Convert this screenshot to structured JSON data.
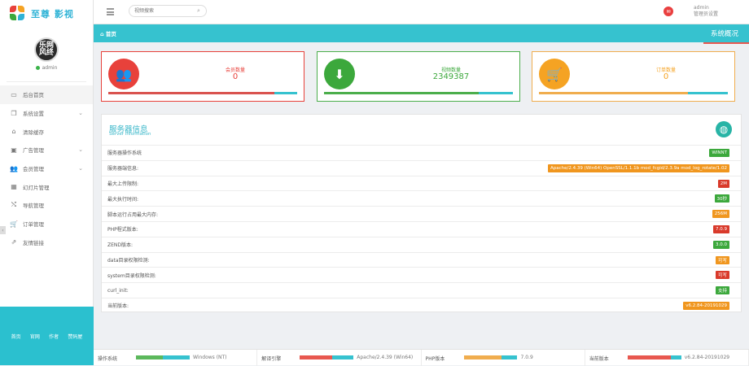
{
  "brand": {
    "name": "至尊 影视"
  },
  "profile": {
    "avatar_text": "乐网\n风终",
    "username": "admin"
  },
  "nav": [
    {
      "label": "后台首页",
      "icon": "monitor-icon",
      "has_chevron": false
    },
    {
      "label": "系统设置",
      "icon": "copy-icon",
      "has_chevron": true
    },
    {
      "label": "清除缓存",
      "icon": "building-icon",
      "has_chevron": false
    },
    {
      "label": "广告管理",
      "icon": "image-icon",
      "has_chevron": true
    },
    {
      "label": "会员管理",
      "icon": "users-icon",
      "has_chevron": true
    },
    {
      "label": "幻灯片管理",
      "icon": "table-icon",
      "has_chevron": false
    },
    {
      "label": "导航管理",
      "icon": "shuffle-icon",
      "has_chevron": false
    },
    {
      "label": "订单管理",
      "icon": "cart-icon",
      "has_chevron": false
    },
    {
      "label": "友情链接",
      "icon": "external-link-icon",
      "has_chevron": false
    }
  ],
  "side_footer": [
    "首页",
    "官网",
    "作者",
    "赞码屋"
  ],
  "topbar": {
    "search_placeholder": "视频搜索",
    "user_name": "admin",
    "user_role": "管理员设置"
  },
  "crumb": {
    "home": "首页",
    "title": "系统概况"
  },
  "stats": [
    {
      "label": "会员数量",
      "value": "0",
      "color": "#e8413b",
      "border": "#e8413b",
      "icon": "users-icon",
      "glyph": "👥",
      "bar": [
        {
          "c": "#d9534f",
          "w": 0.88
        },
        {
          "c": "#36c2cf",
          "w": 0.12
        }
      ]
    },
    {
      "label": "视频数量",
      "value": "2349387",
      "color": "#3ca83c",
      "border": "#4cae4c",
      "icon": "download-icon",
      "glyph": "⬇",
      "bar": [
        {
          "c": "#4cae4c",
          "w": 0.82
        },
        {
          "c": "#36c2cf",
          "w": 0.18
        }
      ]
    },
    {
      "label": "订单数量",
      "value": "0",
      "color": "#f5a323",
      "border": "#f0ad4e",
      "icon": "cart-icon",
      "glyph": "🛒",
      "bar": [
        {
          "c": "#f0ad4e",
          "w": 0.79
        },
        {
          "c": "#36c2cf",
          "w": 0.21
        }
      ]
    }
  ],
  "server": {
    "title": "服务器信息",
    "subtitle": "Server information",
    "rows": [
      {
        "label": "服务器操作系统",
        "value": "WINNT",
        "color": "#3ca83c"
      },
      {
        "label": "服务器端信息:",
        "value": "Apache/2.4.39 (Win64) OpenSSL/1.1.1b mod_fcgid/2.3.9a mod_log_rotate/1.02",
        "color": "#f0961e"
      },
      {
        "label": "最大上传限制:",
        "value": "2M",
        "color": "#d93a2b"
      },
      {
        "label": "最大执行时间:",
        "value": "30秒",
        "color": "#3ca83c"
      },
      {
        "label": "脚本运行占用最大内存:",
        "value": "256M",
        "color": "#f0961e"
      },
      {
        "label": "PHP程式版本:",
        "value": "7.0.9",
        "color": "#d93a2b"
      },
      {
        "label": "ZEND版本:",
        "value": "3.0.0",
        "color": "#3ca83c"
      },
      {
        "label": "data目录权限检测:",
        "value": "可写",
        "color": "#f0961e"
      },
      {
        "label": "system目录权限检测:",
        "value": "可写",
        "color": "#d93a2b"
      },
      {
        "label": "curl_init:",
        "value": "支持",
        "color": "#3ca83c"
      },
      {
        "label": "当前版本:",
        "value": "v6.2.84-20191029",
        "color": "#f0961e"
      }
    ]
  },
  "footer": [
    {
      "label": "操作系统",
      "value": "Windows (NT)",
      "bar": [
        {
          "c": "#5cb85c",
          "w": 0.5
        },
        {
          "c": "#36c2cf",
          "w": 0.5
        }
      ]
    },
    {
      "label": "解译引擎",
      "value": "Apache/2.4.39 (Win64)",
      "bar": [
        {
          "c": "#e8584f",
          "w": 0.6
        },
        {
          "c": "#36c2cf",
          "w": 0.4
        }
      ]
    },
    {
      "label": "PHP版本",
      "value": "7.0.9",
      "bar": [
        {
          "c": "#f0ad4e",
          "w": 0.7
        },
        {
          "c": "#36c2cf",
          "w": 0.3
        }
      ]
    },
    {
      "label": "当前版本",
      "value": "v6.2.84-20191029",
      "bar": [
        {
          "c": "#e8584f",
          "w": 0.8
        },
        {
          "c": "#36c2cf",
          "w": 0.2
        }
      ]
    }
  ]
}
